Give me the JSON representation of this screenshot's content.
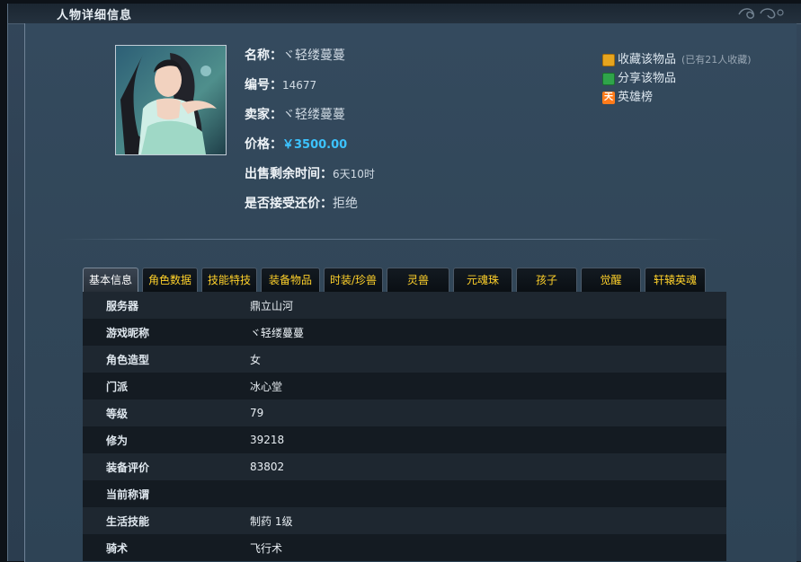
{
  "header": {
    "title": "人物详细信息"
  },
  "item": {
    "name_label": "名称：",
    "name_value": "ヾ轻缕蔓蔓",
    "id_label": "编号：",
    "id_value": "14677",
    "seller_label": "卖家：",
    "seller_value": "ヾ轻缕蔓蔓",
    "price_label": "价格：",
    "price_value": "￥3500.00",
    "time_label": "出售剩余时间：",
    "time_value": "6天10时",
    "bargain_label": "是否接受还价：",
    "bargain_value": "拒绝"
  },
  "actions": {
    "favorite": "收藏该物品",
    "favorite_count": "(已有21人收藏)",
    "share": "分享该物品",
    "hero_icon": "天",
    "hero": "英雄榜"
  },
  "tabs": [
    "基本信息",
    "角色数据",
    "技能特技",
    "装备物品",
    "时装/珍兽",
    "灵兽",
    "元魂珠",
    "孩子",
    "觉醒",
    "轩辕英魂"
  ],
  "basic_info": [
    {
      "label": "服务器",
      "value": "鼎立山河"
    },
    {
      "label": "游戏昵称",
      "value": "ヾ轻缕蔓蔓"
    },
    {
      "label": "角色造型",
      "value": "女"
    },
    {
      "label": "门派",
      "value": "冰心堂"
    },
    {
      "label": "等级",
      "value": "79"
    },
    {
      "label": "修为",
      "value": "39218"
    },
    {
      "label": "装备评价",
      "value": "83802"
    },
    {
      "label": "当前称谓",
      "value": ""
    },
    {
      "label": "生活技能",
      "value": "制药 1级"
    },
    {
      "label": "骑术",
      "value": "飞行术"
    }
  ],
  "colors": {
    "price": "#3cc3ff",
    "tab_text": "#ffd12a",
    "panel": "#2f4457"
  }
}
